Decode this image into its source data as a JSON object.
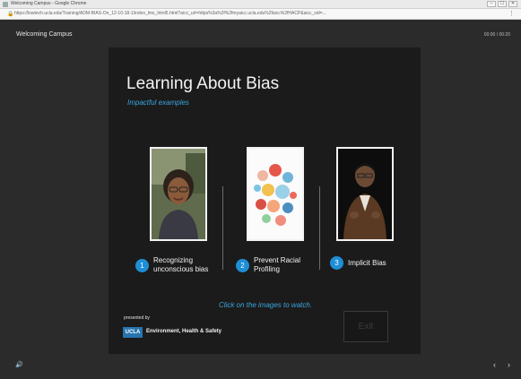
{
  "browser": {
    "window_title": "Welcoming Campus - Google Chrome",
    "url": "https://lowtech.ucla.edu/Training/ADM-BIAS-On_12-10-18-1/index_lms_html5.html?aicc_url=https%3a%2f%2fmyaicc.ucla.edu%2faicc%2fHACP&aicc_sid=...",
    "window_buttons": [
      "–",
      "☐",
      "✕"
    ]
  },
  "player": {
    "title": "Welcoming Campus",
    "time": "00:00 / 00:20"
  },
  "slide": {
    "title": "Learning About Bias",
    "subtitle": "Impactful examples",
    "items": [
      {
        "number": "1",
        "label": "Recognizing unconscious bias"
      },
      {
        "number": "2",
        "label": "Prevent Racial Profiling"
      },
      {
        "number": "3",
        "label": "Implicit Bias"
      }
    ],
    "instruction": "Click on the images to watch.",
    "presented_by": "presented by",
    "logo_text": "UCLA",
    "org_name": "Environment, Health & Safety",
    "exit_label": "Exit"
  },
  "controls": {
    "volume_icon": "🔊",
    "prev_icon": "‹",
    "next_icon": "›"
  },
  "colors": {
    "accent": "#1e8fd6",
    "subtitle": "#3aa6e0",
    "background": "#2b2b2b",
    "slide": "#1b1b1b"
  }
}
